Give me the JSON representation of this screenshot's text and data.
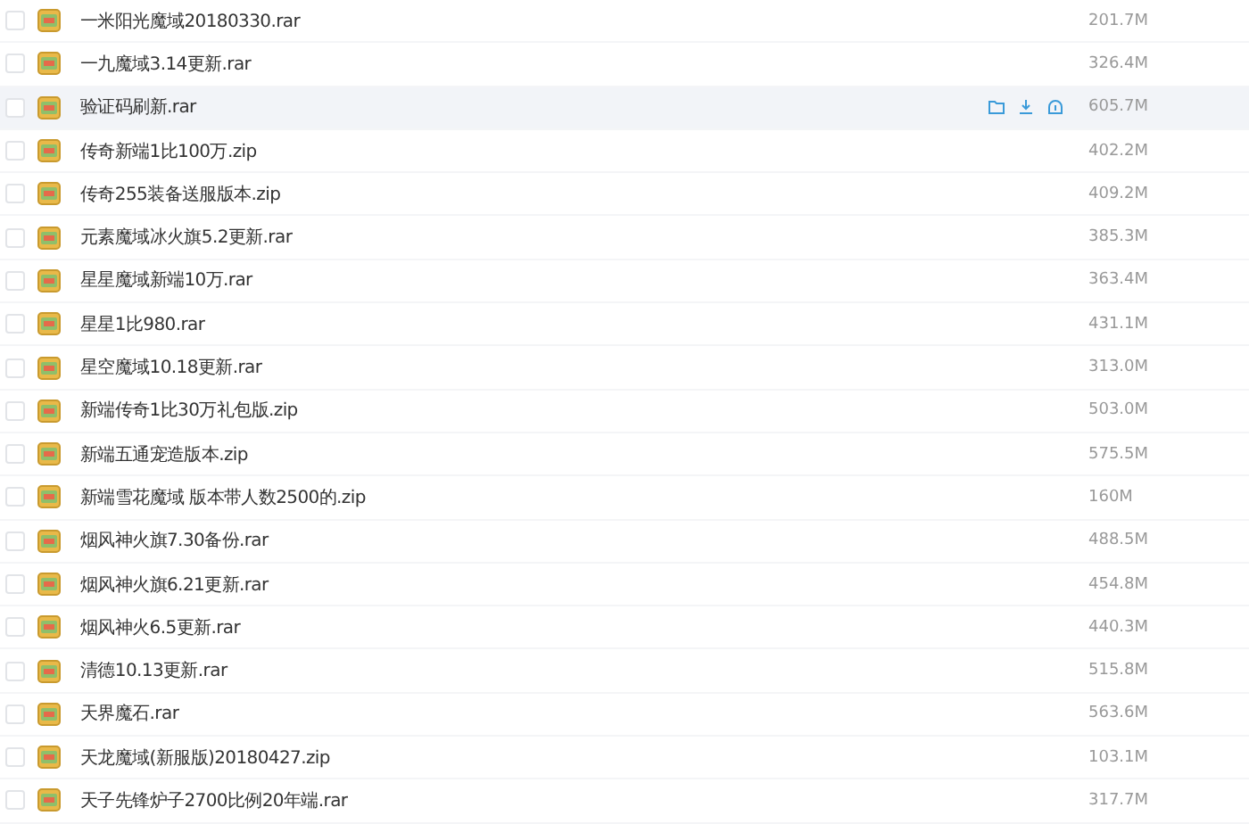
{
  "files": [
    {
      "name": "一米阳光魔域20180330.rar",
      "size": "201.7M",
      "checked": false,
      "hovered": false
    },
    {
      "name": "一九魔域3.14更新.rar",
      "size": "326.4M",
      "checked": false,
      "hovered": false
    },
    {
      "name": "验证码刷新.rar",
      "size": "605.7M",
      "checked": false,
      "hovered": true
    },
    {
      "name": "传奇新端1比100万.zip",
      "size": "402.2M",
      "checked": false,
      "hovered": false
    },
    {
      "name": "传奇255装备送服版本.zip",
      "size": "409.2M",
      "checked": false,
      "hovered": false
    },
    {
      "name": "元素魔域冰火旗5.2更新.rar",
      "size": "385.3M",
      "checked": false,
      "hovered": false
    },
    {
      "name": "星星魔域新端10万.rar",
      "size": "363.4M",
      "checked": false,
      "hovered": false
    },
    {
      "name": "星星1比980.rar",
      "size": "431.1M",
      "checked": false,
      "hovered": false
    },
    {
      "name": "星空魔域10.18更新.rar",
      "size": "313.0M",
      "checked": false,
      "hovered": false
    },
    {
      "name": "新端传奇1比30万礼包版.zip",
      "size": "503.0M",
      "checked": false,
      "hovered": false
    },
    {
      "name": "新端五通宠造版本.zip",
      "size": "575.5M",
      "checked": false,
      "hovered": false
    },
    {
      "name": "新端雪花魔域 版本带人数2500的.zip",
      "size": "160M",
      "checked": false,
      "hovered": false
    },
    {
      "name": "烟风神火旗7.30备份.rar",
      "size": "488.5M",
      "checked": false,
      "hovered": false
    },
    {
      "name": "烟风神火旗6.21更新.rar",
      "size": "454.8M",
      "checked": false,
      "hovered": false
    },
    {
      "name": "烟风神火6.5更新.rar",
      "size": "440.3M",
      "checked": false,
      "hovered": false
    },
    {
      "name": "清德10.13更新.rar",
      "size": "515.8M",
      "checked": false,
      "hovered": false
    },
    {
      "name": "天界魔石.rar",
      "size": "563.6M",
      "checked": false,
      "hovered": false
    },
    {
      "name": "天龙魔域(新服版)20180427.zip",
      "size": "103.1M",
      "checked": false,
      "hovered": false
    },
    {
      "name": "天子先锋炉子2700比例20年端.rar",
      "size": "317.7M",
      "checked": false,
      "hovered": false
    }
  ]
}
